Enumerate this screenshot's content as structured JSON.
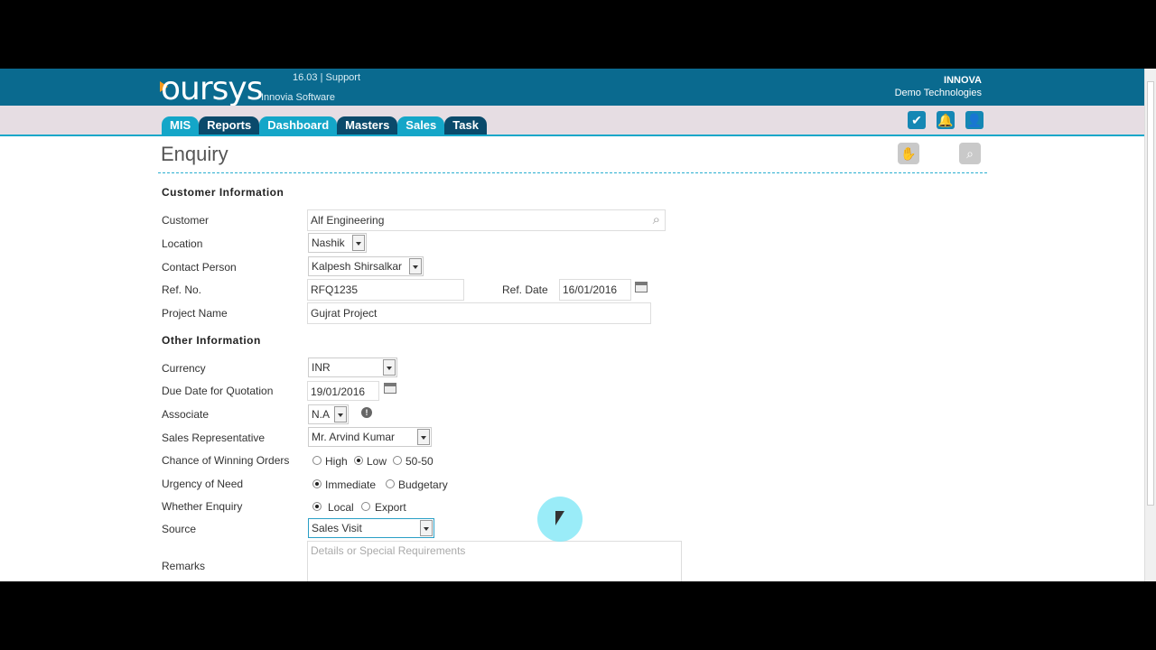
{
  "header": {
    "logo": "oursys",
    "version_support": "16.03 | Support",
    "company_sub": "Innovia Software",
    "company_name": "INNOVA",
    "company_name2": "Demo Technologies"
  },
  "nav": {
    "tabs": [
      "MIS",
      "Reports",
      "Dashboard",
      "Masters",
      "Sales",
      "Task"
    ]
  },
  "page": {
    "title": "Enquiry"
  },
  "customer_info": {
    "heading": "Customer Information",
    "customer_label": "Customer",
    "customer_value": "Alf Engineering",
    "location_label": "Location",
    "location_value": "Nashik",
    "contact_label": "Contact Person",
    "contact_value": "Kalpesh Shirsalkar",
    "refno_label": "Ref. No.",
    "refno_value": "RFQ1235",
    "refdate_label": "Ref. Date",
    "refdate_value": "16/01/2016",
    "project_label": "Project Name",
    "project_value": "Gujrat Project"
  },
  "other_info": {
    "heading": "Other Information",
    "currency_label": "Currency",
    "currency_value": "INR",
    "duedate_label": "Due Date for Quotation",
    "duedate_value": "19/01/2016",
    "associate_label": "Associate",
    "associate_value": "N.A",
    "salesrep_label": "Sales Representative",
    "salesrep_value": "Mr. Arvind Kumar",
    "chance_label": "Chance of Winning Orders",
    "chance_options": [
      "High",
      "Low",
      "50-50"
    ],
    "urgency_label": "Urgency of Need",
    "urgency_options": [
      "Immediate",
      "Budgetary"
    ],
    "whether_label": "Whether Enquiry",
    "whether_options": [
      "Local",
      "Export"
    ],
    "source_label": "Source",
    "source_value": "Sales Visit",
    "remarks_label": "Remarks",
    "remarks_placeholder": "Details or Special Requirements"
  }
}
